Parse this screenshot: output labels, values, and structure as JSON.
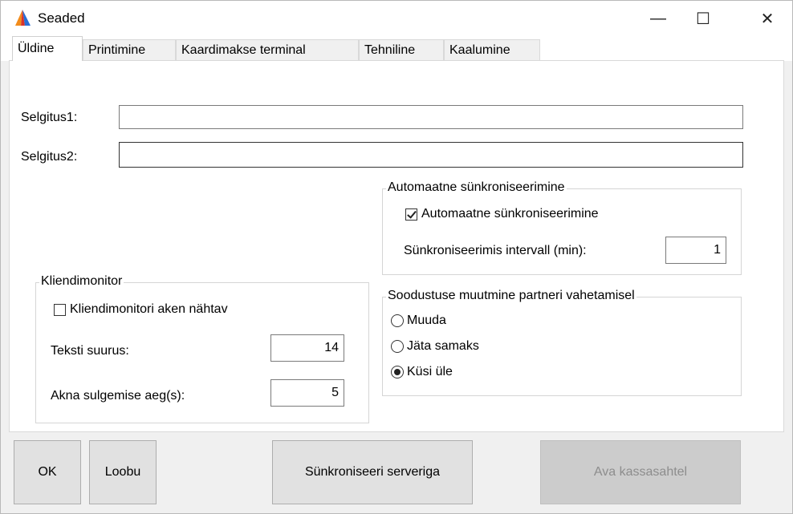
{
  "window": {
    "title": "Seaded",
    "minimize": "—",
    "maximize": "☐",
    "close": "✕"
  },
  "tabs": [
    {
      "label": "Üldine"
    },
    {
      "label": "Printimine"
    },
    {
      "label": "Kaardimakse terminal"
    },
    {
      "label": "Tehniline"
    },
    {
      "label": "Kaalumine"
    }
  ],
  "general": {
    "selgitus1_label": "Selgitus1:",
    "selgitus1_value": "",
    "selgitus2_label": "Selgitus2:",
    "selgitus2_value": ""
  },
  "auto_sync": {
    "group_title": "Automaatne sünkroniseerimine",
    "checkbox_label": "Automaatne sünkroniseerimine",
    "checkbox_checked": true,
    "interval_label": "Sünkroniseerimis intervall (min):",
    "interval_value": "1"
  },
  "client_monitor": {
    "group_title": "Kliendimonitor",
    "checkbox_label": "Kliendimonitori aken nähtav",
    "checkbox_checked": false,
    "text_size_label": "Teksti suurus:",
    "text_size_value": "14",
    "close_time_label": "Akna sulgemise aeg(s):",
    "close_time_value": "5"
  },
  "discount_change": {
    "group_title": "Soodustuse muutmine partneri vahetamisel",
    "options": [
      {
        "label": "Muuda",
        "checked": false
      },
      {
        "label": "Jäta samaks",
        "checked": false
      },
      {
        "label": "Küsi üle",
        "checked": true
      }
    ]
  },
  "buttons": {
    "ok": "OK",
    "cancel": "Loobu",
    "sync": "Sünkroniseeri serveriga",
    "open_drawer": "Ava kassasahtel"
  },
  "colors": {
    "app_icon_orange": "#f28c1b",
    "app_icon_blue": "#2a6fd6",
    "app_icon_red": "#d9342b"
  }
}
